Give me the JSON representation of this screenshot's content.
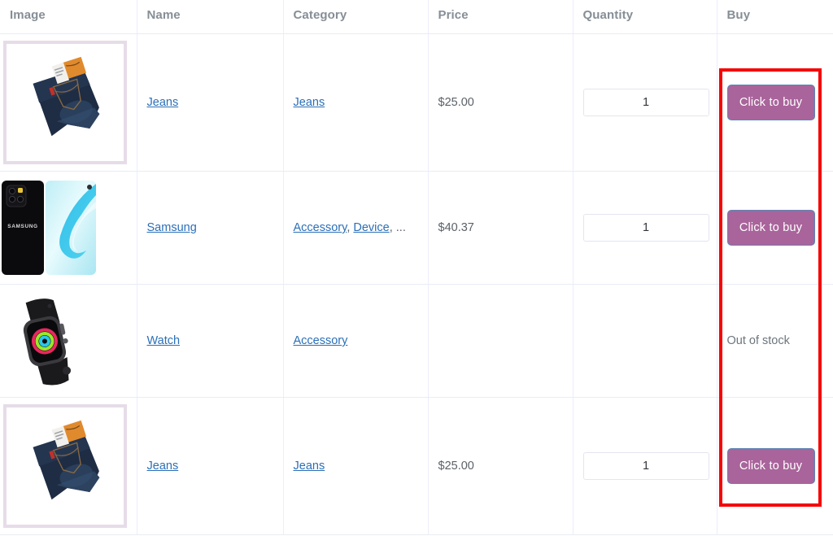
{
  "table": {
    "columns": [
      {
        "key": "image",
        "label": "Image"
      },
      {
        "key": "name",
        "label": "Name"
      },
      {
        "key": "category",
        "label": "Category"
      },
      {
        "key": "price",
        "label": "Price"
      },
      {
        "key": "quantity",
        "label": "Quantity"
      },
      {
        "key": "buy",
        "label": "Buy"
      }
    ],
    "rows": [
      {
        "image_alt": "jeans-thumbnail",
        "name": "Jeans",
        "categories": [
          "Jeans"
        ],
        "category_more": "",
        "price": "$25.00",
        "quantity": "1",
        "buy_label": "Click to buy",
        "in_stock": true
      },
      {
        "image_alt": "samsung-phone-thumbnail",
        "name": "Samsung",
        "categories": [
          "Accessory",
          "Device"
        ],
        "category_more": ", ...",
        "price": "$40.37",
        "quantity": "1",
        "buy_label": "Click to buy",
        "in_stock": true
      },
      {
        "image_alt": "apple-watch-thumbnail",
        "name": "Watch",
        "categories": [
          "Accessory"
        ],
        "category_more": "",
        "price": "",
        "quantity": "",
        "buy_label": "Out of stock",
        "in_stock": false
      },
      {
        "image_alt": "jeans-thumbnail",
        "name": "Jeans",
        "categories": [
          "Jeans"
        ],
        "category_more": "",
        "price": "$25.00",
        "quantity": "1",
        "buy_label": "Click to buy",
        "in_stock": true
      }
    ]
  },
  "annotation": {
    "highlight_color": "#f50505",
    "highlight_target": "buy-column"
  },
  "colors": {
    "link": "#2a6fb8",
    "buy_button_background": "#a9649b",
    "buy_button_border": "#5b86b5",
    "header_text": "#868e96",
    "body_text": "#5b6168",
    "grid_line": "#e9ecf5"
  },
  "category_separator": ", "
}
